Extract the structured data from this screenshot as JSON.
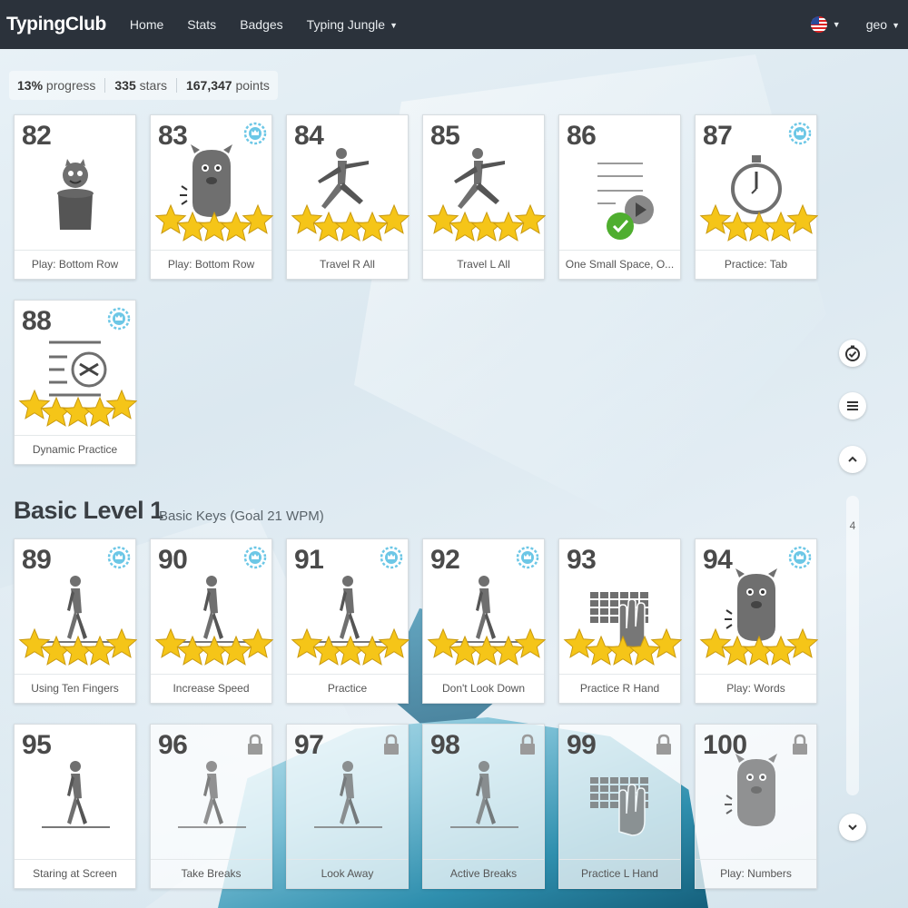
{
  "nav": {
    "brand": "TypingClub",
    "links": [
      "Home",
      "Stats",
      "Badges",
      "Typing Jungle"
    ],
    "user": "geo"
  },
  "summary": {
    "progress_value": "13%",
    "progress_label": "progress",
    "stars_value": "335",
    "stars_label": "stars",
    "points_value": "167,347",
    "points_label": "points"
  },
  "cards": [
    {
      "num": "82",
      "label": "Play: Bottom Row",
      "art": "monster-jar",
      "stars": 0,
      "badge": false,
      "locked": false
    },
    {
      "num": "83",
      "label": "Play: Bottom Row",
      "art": "monster",
      "stars": 5,
      "badge": true,
      "locked": false
    },
    {
      "num": "84",
      "label": "Travel R All",
      "art": "runner",
      "stars": 5,
      "badge": false,
      "locked": false
    },
    {
      "num": "85",
      "label": "Travel L All",
      "art": "runner",
      "stars": 5,
      "badge": false,
      "locked": false
    },
    {
      "num": "86",
      "label": "One Small Space, O...",
      "art": "space-check",
      "stars": 0,
      "badge": false,
      "locked": false
    },
    {
      "num": "87",
      "label": "Practice: Tab",
      "art": "stopwatch",
      "stars": 5,
      "badge": true,
      "locked": false
    },
    {
      "num": "88",
      "label": "Dynamic Practice",
      "art": "shuffle",
      "stars": 5,
      "badge": true,
      "locked": false
    },
    {
      "num": "89",
      "label": "Using Ten Fingers",
      "art": "walker",
      "stars": 5,
      "badge": true,
      "locked": false
    },
    {
      "num": "90",
      "label": "Increase Speed",
      "art": "walker",
      "stars": 5,
      "badge": true,
      "locked": false
    },
    {
      "num": "91",
      "label": "Practice",
      "art": "walker",
      "stars": 5,
      "badge": true,
      "locked": false
    },
    {
      "num": "92",
      "label": "Don't Look Down",
      "art": "walker",
      "stars": 5,
      "badge": true,
      "locked": false
    },
    {
      "num": "93",
      "label": "Practice R Hand",
      "art": "hand",
      "stars": 5,
      "badge": false,
      "locked": false
    },
    {
      "num": "94",
      "label": "Play: Words",
      "art": "monster",
      "stars": 5,
      "badge": true,
      "locked": false
    },
    {
      "num": "95",
      "label": "Staring at Screen",
      "art": "walker",
      "stars": 0,
      "badge": false,
      "locked": false
    },
    {
      "num": "96",
      "label": "Take Breaks",
      "art": "walker",
      "stars": 0,
      "badge": false,
      "locked": true
    },
    {
      "num": "97",
      "label": "Look Away",
      "art": "walker",
      "stars": 0,
      "badge": false,
      "locked": true
    },
    {
      "num": "98",
      "label": "Active Breaks",
      "art": "walker",
      "stars": 0,
      "badge": false,
      "locked": true
    },
    {
      "num": "99",
      "label": "Practice L Hand",
      "art": "hand",
      "stars": 0,
      "badge": false,
      "locked": true
    },
    {
      "num": "100",
      "label": "Play: Numbers",
      "art": "monster",
      "stars": 0,
      "badge": false,
      "locked": true
    }
  ],
  "section": {
    "title": "Basic Level 1",
    "subtitle": "Basic Keys (Goal 21 WPM)"
  },
  "scroll": {
    "page_number": "4"
  },
  "icons": {
    "goal": "check-circle-icon",
    "menu": "list-icon",
    "up": "chevron-up-icon",
    "down": "chevron-down-icon",
    "badge": "crown-badge-icon",
    "lock": "lock-icon",
    "star": "star-icon"
  },
  "colors": {
    "nav_bg": "#2b323b",
    "star": "#f5c518",
    "badge": "#6cc7e6",
    "check": "#4fae2f"
  }
}
